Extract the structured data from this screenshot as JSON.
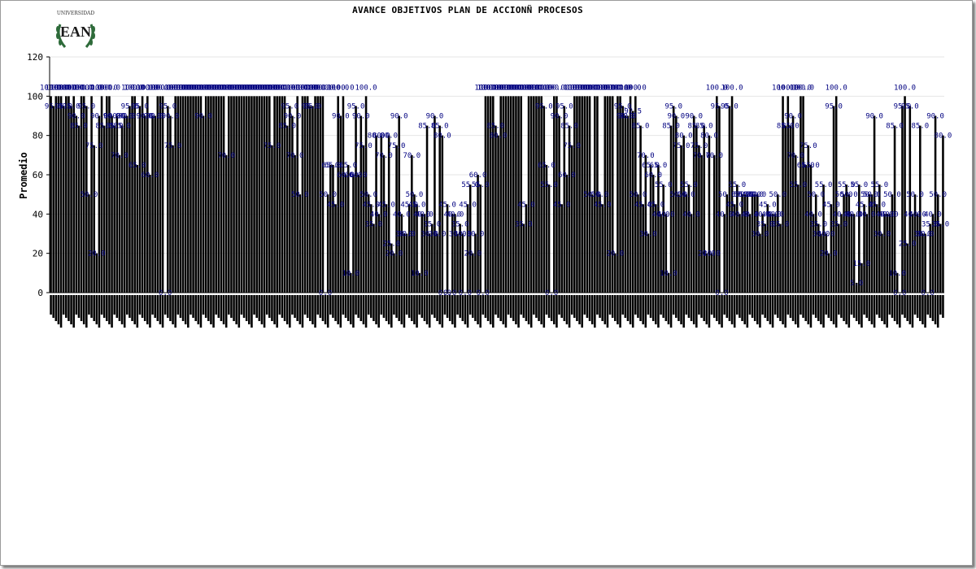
{
  "logo": {
    "text_top": "UNIVERSIDAD",
    "text_main": "EAN"
  },
  "colors": {
    "bars": "#000000",
    "labels": "#000080",
    "grid": "#e6e6e6",
    "frame": "#9a9a9a"
  },
  "chart_data": {
    "type": "bar",
    "title": "AVANCE OBJETIVOS PLAN DE ACCIONÑ PROCESOS",
    "ylabel": "Promedio",
    "xlabel": "",
    "ylim": [
      0,
      120
    ],
    "yticks": [
      0,
      20,
      40,
      60,
      80,
      100,
      120
    ],
    "grid": true,
    "legend": "none",
    "value_label_format": "one decimal",
    "series": [
      {
        "values": [
          100,
          95,
          100,
          100,
          100,
          95,
          100,
          100,
          95,
          100,
          90,
          85,
          100,
          100,
          95,
          50,
          100,
          75,
          20,
          90,
          100,
          85,
          100,
          100,
          90,
          85,
          90,
          70,
          85,
          90,
          90,
          95,
          100,
          100,
          65,
          95,
          100,
          90,
          100,
          60,
          90,
          90,
          100,
          100,
          100,
          0,
          95,
          90,
          75,
          100,
          100,
          100,
          100,
          100,
          100,
          100,
          100,
          100,
          100,
          100,
          90,
          100,
          100,
          100,
          100,
          100,
          100,
          100,
          100,
          70,
          100,
          100,
          100,
          100,
          100,
          100,
          100,
          100,
          100,
          100,
          100,
          100,
          100,
          100,
          100,
          100,
          100,
          75,
          100,
          100,
          100,
          100,
          100,
          85,
          95,
          90,
          70,
          100,
          50,
          100,
          100,
          100,
          95,
          95,
          100,
          100,
          100,
          100,
          0,
          50,
          65,
          65,
          45,
          100,
          90,
          100,
          60,
          65,
          10,
          60,
          95,
          60,
          90,
          75,
          100,
          50,
          45,
          35,
          80,
          40,
          80,
          70,
          45,
          80,
          25,
          20,
          75,
          90,
          40,
          30,
          30,
          45,
          70,
          50,
          45,
          10,
          40,
          40,
          85,
          30,
          35,
          90,
          30,
          85,
          80,
          0,
          45,
          0,
          40,
          40,
          30,
          35,
          30,
          0,
          45,
          55,
          20,
          30,
          60,
          55,
          0,
          100,
          100,
          100,
          100,
          85,
          80,
          100,
          100,
          100,
          100,
          100,
          100,
          100,
          100,
          100,
          35,
          45,
          100,
          100,
          100,
          100,
          100,
          100,
          95,
          65,
          55,
          0,
          100,
          100,
          90,
          45,
          95,
          60,
          85,
          75,
          100,
          100,
          100,
          100,
          100,
          100,
          100,
          50,
          100,
          100,
          50,
          45,
          100,
          100,
          100,
          100,
          20,
          100,
          100,
          95,
          90,
          90,
          100,
          92.5,
          100,
          50,
          85,
          45,
          70,
          30,
          65,
          60,
          45,
          65,
          40,
          55,
          40,
          10,
          85,
          95,
          90,
          50,
          75,
          80,
          50,
          55,
          40,
          90,
          85,
          75,
          70,
          85,
          20,
          80,
          20,
          70,
          100,
          95,
          0,
          40,
          50,
          95,
          100,
          45,
          55,
          40,
          50,
          50,
          50,
          40,
          50,
          50,
          50,
          30,
          40,
          35,
          45,
          40,
          40,
          40,
          50,
          35,
          100,
          85,
          100,
          85,
          90,
          70,
          55,
          100,
          100,
          65,
          75,
          65,
          40,
          50,
          35,
          30,
          55,
          30,
          20,
          45,
          95,
          100,
          35,
          40,
          50,
          55,
          50,
          40,
          40,
          5,
          55,
          15,
          45,
          40,
          50,
          50,
          90,
          45,
          55,
          30,
          40,
          40,
          40,
          50,
          85,
          10,
          0,
          95,
          100,
          25,
          95,
          40,
          50,
          40,
          85,
          30,
          30,
          0,
          35,
          40,
          90,
          50,
          35,
          80
        ]
      }
    ],
    "categories": []
  }
}
